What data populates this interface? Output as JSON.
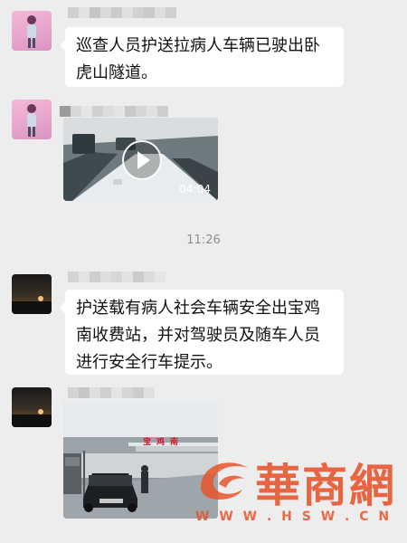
{
  "chat": {
    "messages": [
      {
        "id": "m1",
        "text": "巡查人员护送拉病人车辆已驶出卧虎山隧道。"
      },
      {
        "id": "m2",
        "video_duration": "04:04"
      },
      {
        "id": "m3",
        "timestamp": "11:26"
      },
      {
        "id": "m4",
        "text": "护送载有病人社会车辆安全出宝鸡南收费站，并对驾驶员及随车人员进行安全行车提示。"
      },
      {
        "id": "m5",
        "image_label": "宝鸡南"
      }
    ]
  },
  "watermark": {
    "logo_text": "華商網",
    "url_text": "W W W . H S W . C N",
    "color": "#e8532a"
  },
  "colors": {
    "chat_bg": "#ededed",
    "bubble_bg": "#ffffff",
    "text": "#111111",
    "timestamp": "#8f8f8f"
  }
}
